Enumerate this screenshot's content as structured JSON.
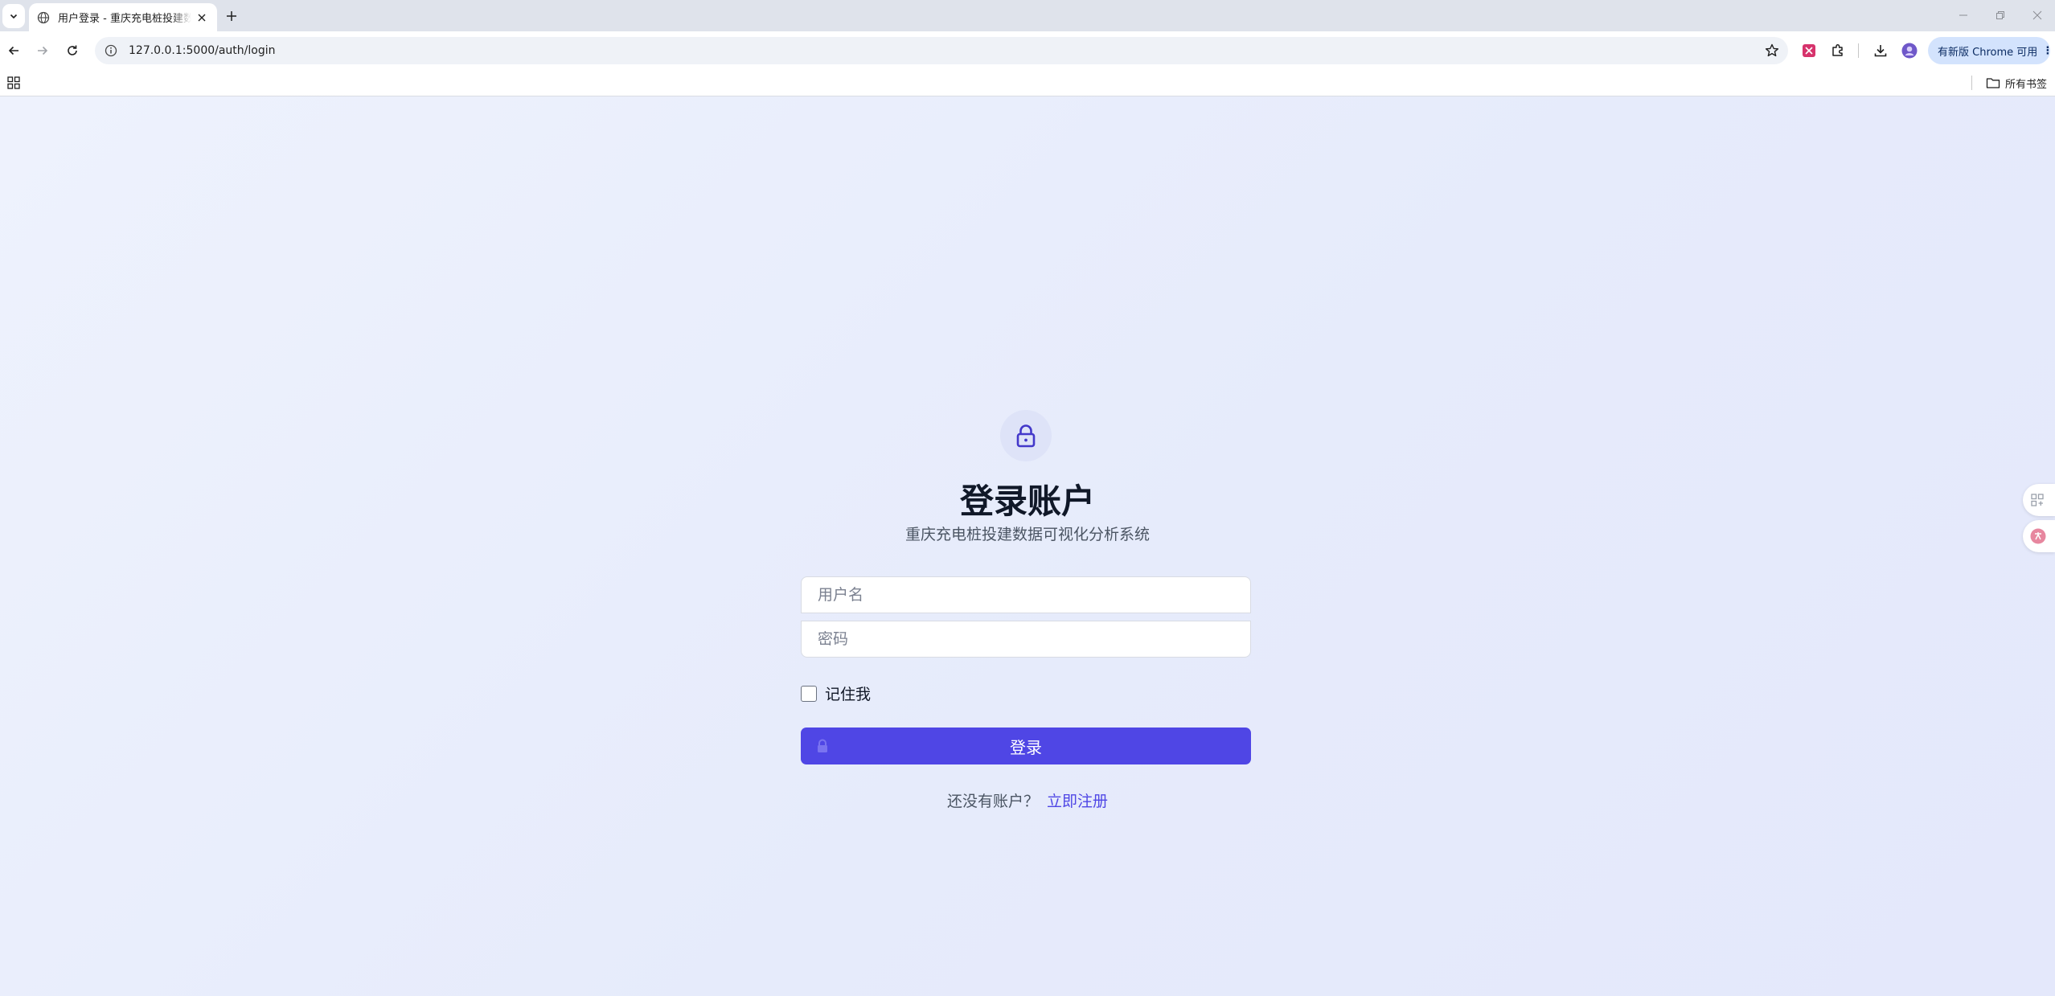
{
  "browser": {
    "tab_title": "用户登录 - 重庆充电桩投建数据可视化分析系统",
    "url": "127.0.0.1:5000/auth/login",
    "update_button": "有新版 Chrome 可用",
    "all_bookmarks": "所有书签"
  },
  "login": {
    "heading": "登录账户",
    "subtitle": "重庆充电桩投建数据可视化分析系统",
    "username_placeholder": "用户名",
    "password_placeholder": "密码",
    "remember_label": "记住我",
    "submit_label": "登录",
    "register_prompt": "还没有账户？",
    "register_link": "立即注册"
  },
  "colors": {
    "primary": "#4f46e5",
    "page_background": "#e9edfb",
    "heading": "#101828"
  }
}
